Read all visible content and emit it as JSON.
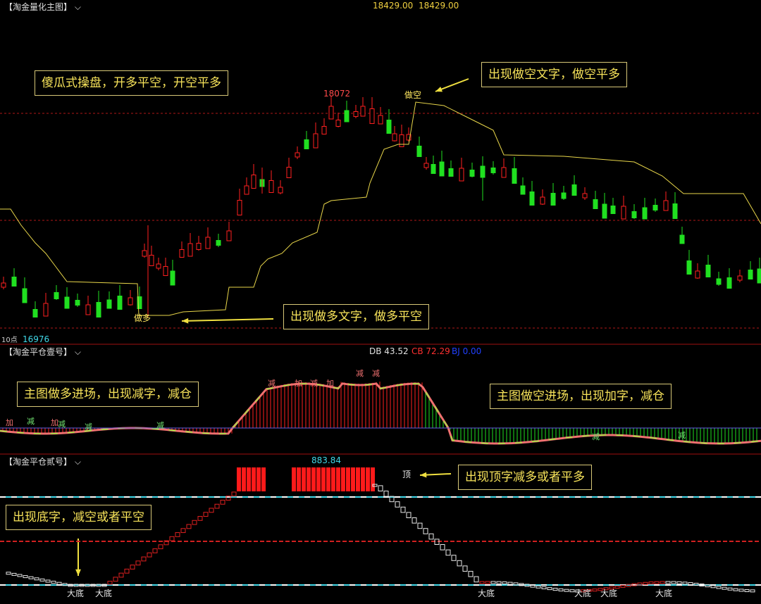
{
  "colors": {
    "up": "#ff2020",
    "down": "#20e020",
    "yellow": "#e8d64a",
    "cyan": "#40d8e8",
    "grid_red": "#b01818",
    "label_yellow": "#f7e35a"
  },
  "main_panel": {
    "title": "【淘金量化主图】",
    "dropdown_icon": "chevron-down-icon",
    "header_value_1": "18429.00",
    "header_value_2": "18429.00",
    "high_label": "18072",
    "low_label": "16976",
    "low_label_prefix": "10点",
    "signal_short": "做空",
    "signal_long": "做多",
    "callout_top_left": "傻瓜式操盘，开多平空，开空平多",
    "callout_top_right": "出现做空文字，做空平多",
    "callout_bottom": "出现做多文字，做多平空"
  },
  "panel2": {
    "title": "【淘金平仓壹号】",
    "dropdown_icon": "chevron-down-icon",
    "db_label": "DB 43.52",
    "cb_label": "CB 72.29",
    "bj_label": "BJ 0.00",
    "callout_left": "主图做多进场，出现减字，减仓",
    "callout_right": "主图做空进场，出现加字，减仓",
    "mark_reduce": "减",
    "mark_add": "加"
  },
  "panel3": {
    "title": "【淘金平仓贰号】",
    "dropdown_icon": "chevron-down-icon",
    "peak_value": "883.84",
    "top_label": "顶",
    "bottom_label": "大底",
    "callout_right": "出现顶字减多或者平多",
    "callout_left": "出现底字，减空或者平空"
  }
}
